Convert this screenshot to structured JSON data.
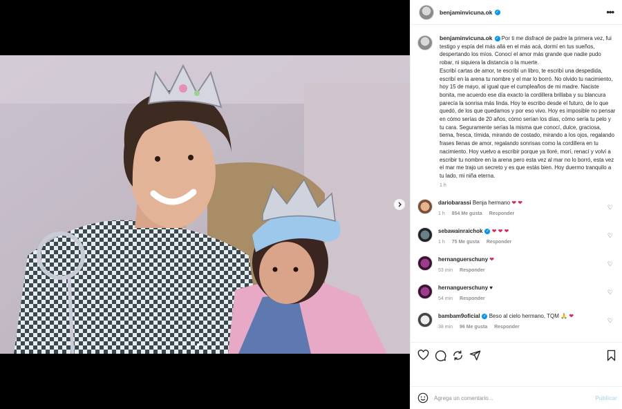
{
  "post": {
    "username": "benjaminvicuna.ok",
    "more_label": "•••",
    "carousel": {
      "current": 1,
      "total": 2
    }
  },
  "caption": {
    "username": "benjaminvicuna.ok",
    "text": "Por ti me disfracé de padre la primera vez, fui testigo y espía del más allá en el más acá, dormí en tus sueños, despertando los míos. Conocí el amor más grande que nadie pudo robar, ni siquiera la distancia o la muerte.",
    "text2": "Escribí cartas de amor, te escribí un libro, te escribí una despedida, escribí en la arena tu nombre y el mar lo borró. No olvido tu nacimiento, hoy 15 de mayo, al igual que el cumpleaños de mi madre. Naciste bonita, me acuerdo ese día exacto la cordillera brillaba y su blancura parecía la sonrisa más linda. Hoy te escribo desde el futuro, de lo que quedó, de los que quedamos y por eso vivo. Hoy es imposible no pensar en cómo serías de 20 años, cómo serían los días, cómo sería tu pelo y tu cara. Seguramente serías la misma que conocí, dulce, graciosa, tierna, fresca, tímida, mirando de costado, mirando a los ojos, regalando frases llenas de amor, regalando sonrisas como la cordillera en tu nacimiento. Hoy vuelvo a escribir porque ya lloré, morí, renací y volví a escribir tu nombre en la arena pero esta vez al mar no lo borró, esta vez el mar me trajo un secreto y es que estás bien. Hoy duermo tranquilo a tu lado, mi niña eterna.",
    "time": "1 h"
  },
  "comments": [
    {
      "username": "dariobarassi",
      "verified": false,
      "text": "Benja hermano",
      "emoji": "❤ ❤",
      "time": "1 h",
      "likes": "854 Me gusta",
      "reply": "Responder"
    },
    {
      "username": "sebawainraichok",
      "verified": true,
      "text": "",
      "emoji": "❤ ❤ ❤",
      "time": "1 h",
      "likes": "75 Me gusta",
      "reply": "Responder"
    },
    {
      "username": "hernanguerschuny",
      "verified": false,
      "text": "",
      "emoji": "❤",
      "time": "53 min",
      "likes": "",
      "reply": "Responder"
    },
    {
      "username": "hernanguerschuny",
      "verified": false,
      "text": "",
      "emoji": "♥",
      "time": "54 min",
      "likes": "",
      "reply": "Responder"
    },
    {
      "username": "bambam9oficial",
      "verified": true,
      "text": "Beso al cielo hermano, TQM",
      "emoji": "🙏 ❤",
      "time": "38 min",
      "likes": "96 Me gusta",
      "reply": "Responder"
    }
  ],
  "add_comment": {
    "placeholder": "Agrega un comentario...",
    "publish_label": "Publicar"
  },
  "icons": [
    "heart-icon",
    "comment-icon",
    "share-icon",
    "send-icon",
    "save-icon",
    "emoji-icon",
    "more-icon",
    "chevron-right-icon"
  ],
  "colors": {
    "accent": "#0095f6",
    "like": "#ed4956",
    "muted": "#8e8e8e"
  }
}
